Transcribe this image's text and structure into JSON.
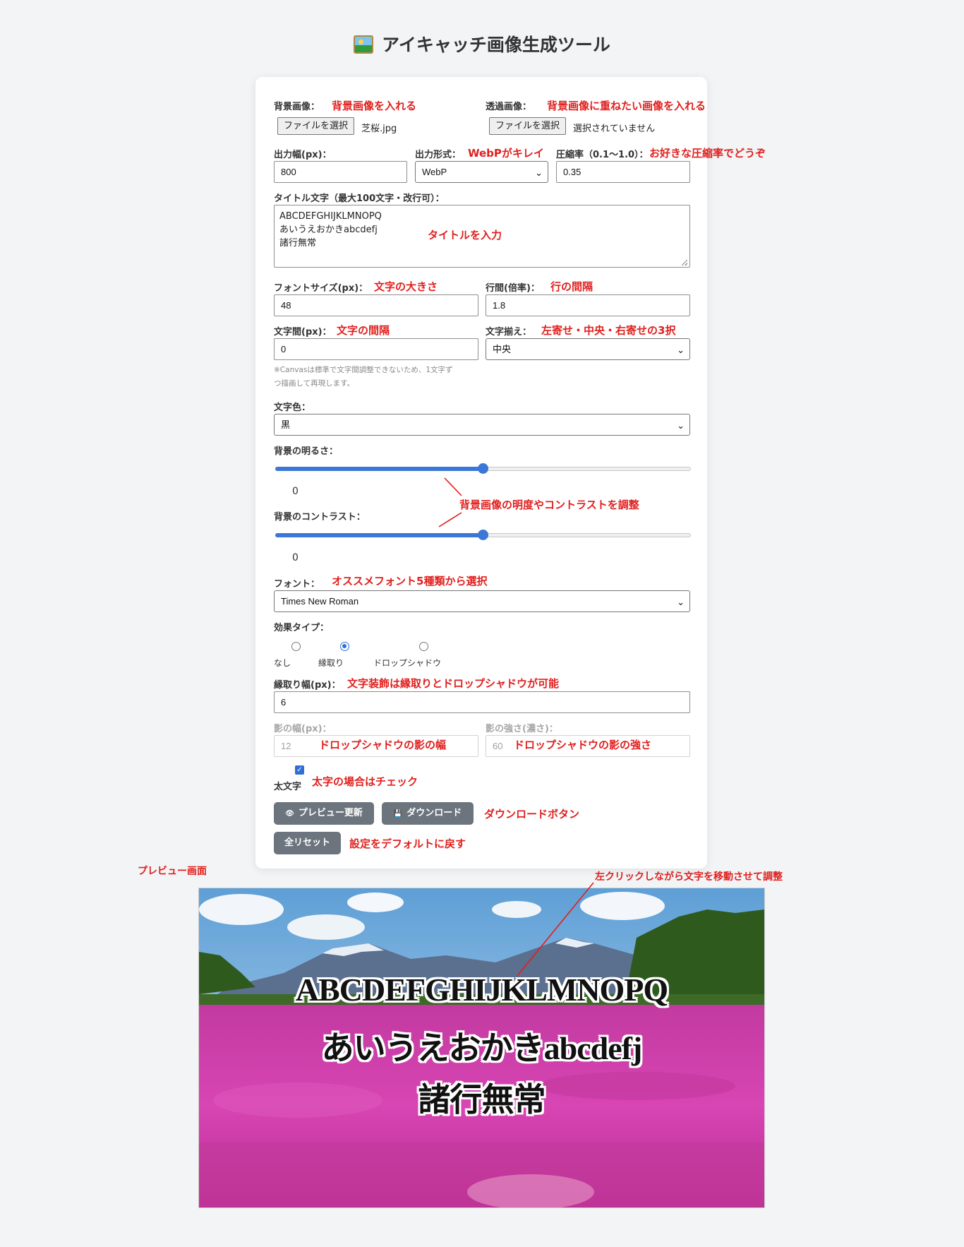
{
  "page": {
    "title": "アイキャッチ画像生成ツール",
    "icon": "framed-picture-icon"
  },
  "form": {
    "bg_image": {
      "label": "背景画像：",
      "button": "ファイルを選択",
      "file": "芝桜.jpg"
    },
    "overlay_image": {
      "label": "透過画像：",
      "button": "ファイルを選択",
      "file": "選択されていません"
    },
    "width": {
      "label": "出力幅(px)：",
      "value": "800"
    },
    "format": {
      "label": "出力形式：",
      "value": "WebP"
    },
    "compression": {
      "label": "圧縮率（0.1〜1.0）：",
      "value": "0.35"
    },
    "title_text": {
      "label": "タイトル文字（最大100文字・改行可）：",
      "value": "ABCDEFGHIJKLMNOPQ\nあいうえおかきabcdefj\n諸行無常"
    },
    "font_size": {
      "label": "フォントサイズ(px)：",
      "value": "48"
    },
    "line_height": {
      "label": "行間(倍率)：",
      "value": "1.8"
    },
    "letter_spacing": {
      "label": "文字間(px)：",
      "value": "0"
    },
    "align": {
      "label": "文字揃え：",
      "value": "中央"
    },
    "spacing_note_1": "※Canvasは標準で文字間調整できないため、1文字ず",
    "spacing_note_2": "つ描画して再現します。",
    "color": {
      "label": "文字色：",
      "value": "黒"
    },
    "brightness": {
      "label": "背景の明るさ：",
      "value": "0",
      "fraction": 0.5
    },
    "contrast": {
      "label": "背景のコントラスト：",
      "value": "0",
      "fraction": 0.5
    },
    "font": {
      "label": "フォント：",
      "value": "Times New Roman"
    },
    "effect": {
      "label": "効果タイプ：",
      "options": [
        "なし",
        "縁取り",
        "ドロップシャドウ"
      ],
      "selected": "縁取り"
    },
    "stroke_width": {
      "label": "縁取り幅(px)：",
      "value": "6"
    },
    "shadow_width": {
      "label": "影の幅(px)：",
      "value": "12"
    },
    "shadow_strength": {
      "label": "影の強さ(濃さ)：",
      "value": "60"
    },
    "bold": {
      "label": "太文字",
      "checked": true
    },
    "buttons": {
      "preview": "プレビュー更新",
      "preview_icon": "eye-icon",
      "download": "ダウンロード",
      "download_icon": "floppy-disk-icon",
      "reset": "全リセット"
    }
  },
  "annotations": {
    "bg": "背景画像を入れる",
    "overlay": "背景画像に重ねたい画像を入れる",
    "format": "WebPがキレイ",
    "compression": "お好きな圧縮率でどうぞ",
    "title": "タイトルを入力",
    "font_size": "文字の大きさ",
    "line_height": "行の間隔",
    "letter_spacing": "文字の間隔",
    "align": "左寄せ・中央・右寄せの3択",
    "brightness_contrast": "背景画像の明度やコントラストを調整",
    "font": "オススメフォント5種類から選択",
    "effect": "文字装飾は縁取りとドロップシャドウが可能",
    "shadow_width": "ドロップシャドウの影の幅",
    "shadow_strength": "ドロップシャドウの影の強さ",
    "bold": "太字の場合はチェック",
    "download": "ダウンロードボタン",
    "reset": "設定をデフォルトに戻す",
    "preview": "プレビュー画面",
    "drag": "左クリックしながら文字を移動させて調整"
  },
  "preview": {
    "lines": [
      "ABCDEFGHIJKLMNOPQ",
      "あいうえおかきabcdefj",
      "諸行無常"
    ],
    "colors": {
      "sky": "#9ec8ec",
      "mountain": "#5b6f8f",
      "flowers": "#d63fb0",
      "trees": "#2f5a1e"
    }
  },
  "colors": {
    "annotation": "#e0201e",
    "accent": "#3b77d6",
    "button": "#6c757d"
  }
}
